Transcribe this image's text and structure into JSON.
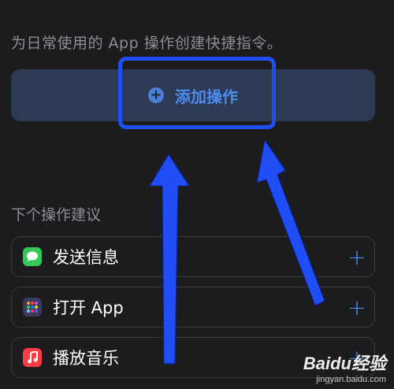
{
  "intro_text": "为日常使用的 App 操作创建快捷指令。",
  "add_action": {
    "label": "添加操作"
  },
  "suggestions_title": "下个操作建议",
  "suggestions": [
    {
      "label": "发送信息",
      "icon": "messages-icon",
      "icon_color": "#34c759"
    },
    {
      "label": "打开 App",
      "icon": "app-grid-icon",
      "icon_color": "#5b5bd6"
    },
    {
      "label": "播放音乐",
      "icon": "music-icon",
      "icon_color": "#fc3c44"
    }
  ],
  "accent_color": "#4f8cf0",
  "annotation_color": "#1f4ef5",
  "watermark": {
    "logo": "Baidu经验",
    "url": "jingyan.baidu.com"
  }
}
